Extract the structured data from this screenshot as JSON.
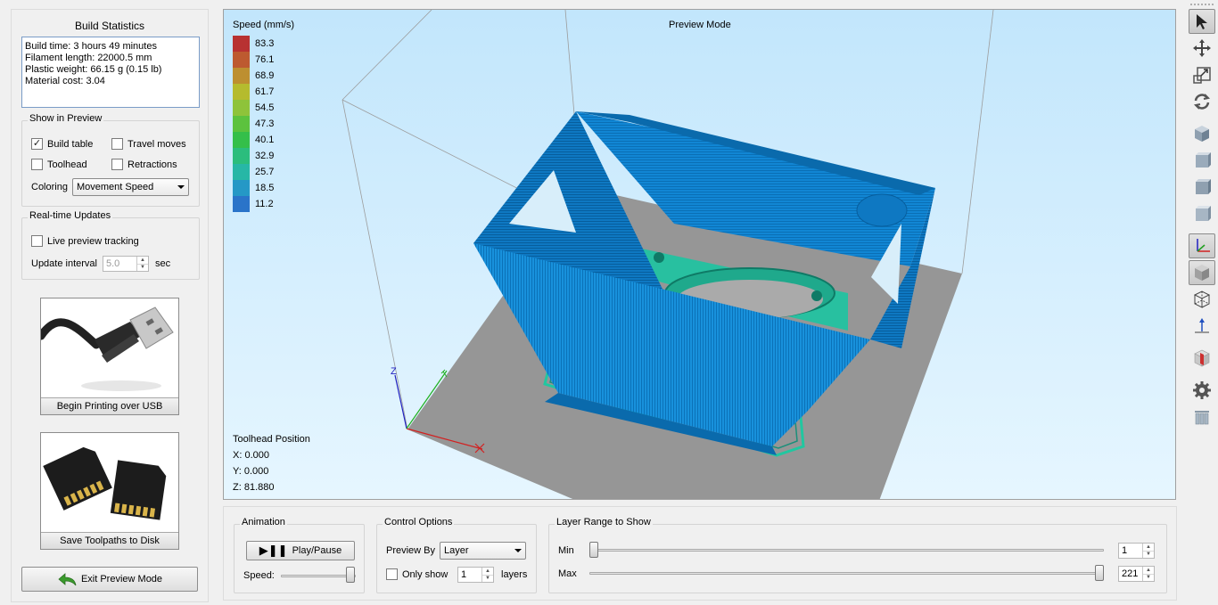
{
  "left": {
    "title": "Build Statistics",
    "stats": [
      "Build time: 3 hours 49 minutes",
      "Filament length: 22000.5 mm",
      "Plastic weight: 66.15 g (0.15 lb)",
      "Material cost: 3.04"
    ],
    "show": {
      "title": "Show in Preview",
      "build_table": "Build table",
      "travel_moves": "Travel moves",
      "toolhead": "Toolhead",
      "retractions": "Retractions",
      "coloring_label": "Coloring",
      "coloring_value": "Movement Speed"
    },
    "realtime": {
      "title": "Real-time Updates",
      "live": "Live preview tracking",
      "interval_label": "Update interval",
      "interval_value": "5.0",
      "interval_unit": "sec"
    },
    "usb_button": "Begin Printing over USB",
    "sd_button": "Save Toolpaths to Disk",
    "exit_button": "Exit Preview Mode"
  },
  "viewport": {
    "mode": "Preview Mode",
    "legend_title": "Speed (mm/s)",
    "legend": [
      {
        "value": "83.3",
        "color": "#b83232"
      },
      {
        "value": "76.1",
        "color": "#bd5a30"
      },
      {
        "value": "68.9",
        "color": "#bd8f30"
      },
      {
        "value": "61.7",
        "color": "#b5bb2e"
      },
      {
        "value": "54.5",
        "color": "#8ec33a"
      },
      {
        "value": "47.3",
        "color": "#5cc23e"
      },
      {
        "value": "40.1",
        "color": "#34bf4a"
      },
      {
        "value": "32.9",
        "color": "#2bbd7d"
      },
      {
        "value": "25.7",
        "color": "#27b7a6"
      },
      {
        "value": "18.5",
        "color": "#2598c6"
      },
      {
        "value": "11.2",
        "color": "#2a74c9"
      }
    ],
    "toolhead_title": "Toolhead Position",
    "x": "X: 0.000",
    "y": "Y: 0.000",
    "z": "Z: 81.880",
    "axis_z": "Z",
    "model_color": "#1186d4",
    "plate_color": "#969696"
  },
  "bottom": {
    "animation": {
      "title": "Animation",
      "play": "Play/Pause",
      "speed": "Speed:"
    },
    "control": {
      "title": "Control Options",
      "preview_by": "Preview By",
      "preview_value": "Layer",
      "only_show": "Only show",
      "layers_value": "1",
      "layers": "layers"
    },
    "range": {
      "title": "Layer Range to Show",
      "min": "Min",
      "max": "Max",
      "min_value": "1",
      "max_value": "221"
    }
  },
  "toolbar": {
    "tools": [
      "select-cursor-icon",
      "move-icon",
      "scale-icon",
      "rotate-icon",
      "view-cube-icon",
      "view-cube-icon",
      "view-cube-icon",
      "view-cube-icon",
      "axes-icon",
      "solid-cube-icon",
      "wireframe-cube-icon",
      "z-axis-icon",
      "section-icon",
      "gear-icon",
      "columns-icon"
    ]
  }
}
